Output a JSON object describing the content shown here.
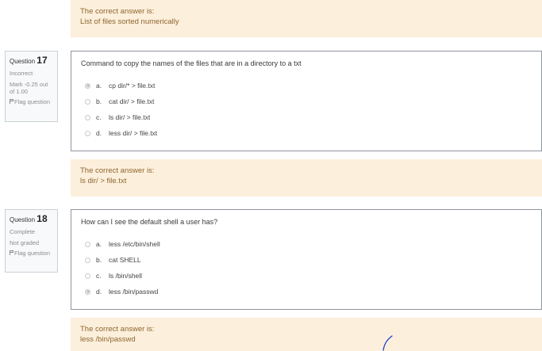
{
  "top_feedback": {
    "heading": "The correct answer is:",
    "answer": "List of files sorted numerically"
  },
  "questions": [
    {
      "label": "Question",
      "number": "17",
      "state": "Incorrect",
      "grade": "Mark -0.25 out of 1.00",
      "flag": "Flag question",
      "text": "Command to copy the names of the files that are in a directory to a txt",
      "options": [
        {
          "letter": "a.",
          "text": "cp dir/* > file.txt",
          "selected": true
        },
        {
          "letter": "b.",
          "text": "cat dir/ > file.txt",
          "selected": false
        },
        {
          "letter": "c.",
          "text": "ls dir/ > file.txt",
          "selected": false
        },
        {
          "letter": "d.",
          "text": "less dir/ > file.txt",
          "selected": false
        }
      ],
      "feedback": {
        "heading": "The correct answer is:",
        "answer": "ls dir/ > file.txt"
      }
    },
    {
      "label": "Question",
      "number": "18",
      "state": "Complete",
      "grade": "Not graded",
      "flag": "Flag question",
      "text": "How can I see the default shell a user has?",
      "options": [
        {
          "letter": "a.",
          "text": "less /etc/bin/shell",
          "selected": false
        },
        {
          "letter": "b.",
          "text": "cat SHELL",
          "selected": false
        },
        {
          "letter": "c.",
          "text": "ls /bin/shell",
          "selected": false
        },
        {
          "letter": "d.",
          "text": "less /bin/passwd",
          "selected": true
        }
      ],
      "feedback": {
        "heading": "The correct answer is:",
        "answer": "less /bin/passwd"
      }
    }
  ],
  "colors": {
    "feedback_bg": "#fcefdc",
    "feedback_text": "#8e662e",
    "pen_mark": "#1f3fd1"
  }
}
